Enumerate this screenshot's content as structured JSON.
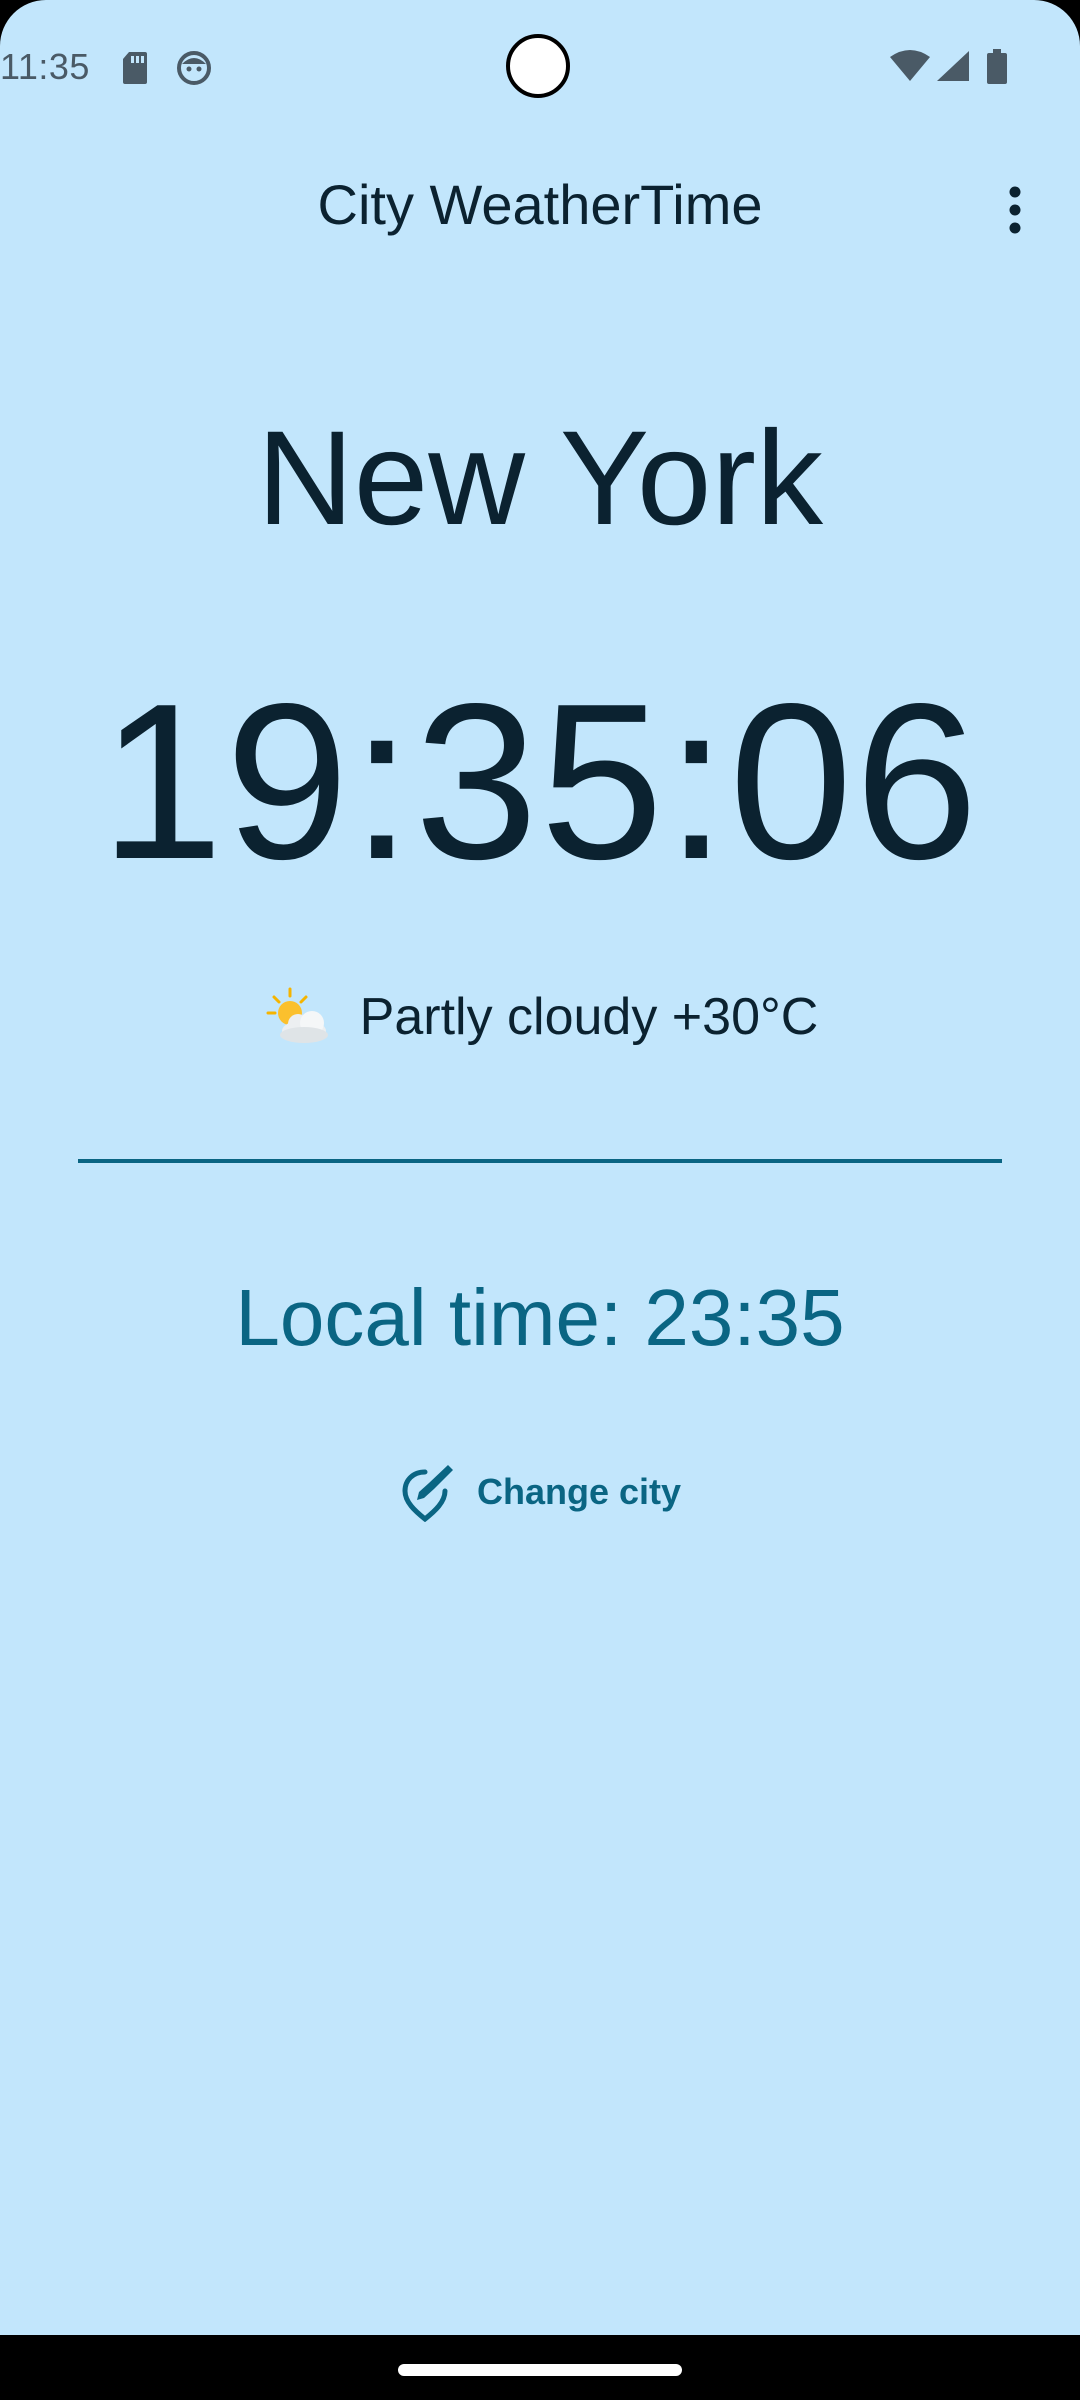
{
  "status_bar": {
    "time": "11:35",
    "icons": [
      "sd-card-icon",
      "face-icon",
      "wifi-icon",
      "cell-signal-icon",
      "battery-icon"
    ]
  },
  "app_bar": {
    "title": "City WeatherTime",
    "menu_icon": "more-vert-icon"
  },
  "main": {
    "city": "New York",
    "clock": "19:35:06",
    "weather": {
      "icon": "sun-behind-cloud-icon",
      "text": "Partly cloudy +30°C"
    },
    "local_time": "Local time: 23:35",
    "change_city": {
      "icon": "edit-location-icon",
      "label": "Change city"
    }
  },
  "colors": {
    "background": "#c2e6fc",
    "primary_text": "#0b2230",
    "accent": "#0a6583"
  }
}
